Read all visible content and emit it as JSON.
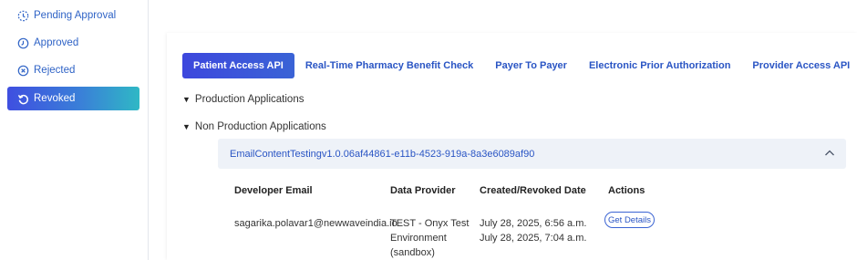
{
  "sidebar": {
    "items": [
      {
        "label": "Pending Approval",
        "icon": "clock-dashed-icon",
        "active": false
      },
      {
        "label": "Approved",
        "icon": "approved-clock-icon",
        "active": false
      },
      {
        "label": "Rejected",
        "icon": "rejected-x-circle-icon",
        "active": false
      },
      {
        "label": "Revoked",
        "icon": "revoke-arrow-icon",
        "active": true
      }
    ]
  },
  "tabs": [
    {
      "label": "Patient Access API",
      "active": true
    },
    {
      "label": "Real-Time Pharmacy Benefit Check",
      "active": false
    },
    {
      "label": "Payer To Payer",
      "active": false
    },
    {
      "label": "Electronic Prior Authorization",
      "active": false
    },
    {
      "label": "Provider Access API",
      "active": false
    }
  ],
  "sections": {
    "production": "Production Applications",
    "non_production": "Non Production Applications"
  },
  "application": {
    "name": "EmailContentTestingv1.0.06af44861-e11b-4523-919a-8a3e6089af90",
    "table": {
      "headers": [
        "Developer Email",
        "Data Provider",
        "Created/Revoked Date",
        "Actions"
      ],
      "row": {
        "email": "sagarika.polavar1@newwaveindia.io",
        "provider_line1": "TEST - Onyx Test",
        "provider_line2": "Environment",
        "provider_line3": "(sandbox)",
        "created": "July 28, 2025, 6:56 a.m.",
        "revoked": "July 28, 2025, 7:04 a.m.",
        "action_label": "Get Details"
      }
    }
  },
  "colors": {
    "accent": "#2a55c4",
    "active_gradient_start": "#3f4fe0",
    "active_gradient_end": "#2fb8c5",
    "header_bg": "#eef2f8"
  }
}
